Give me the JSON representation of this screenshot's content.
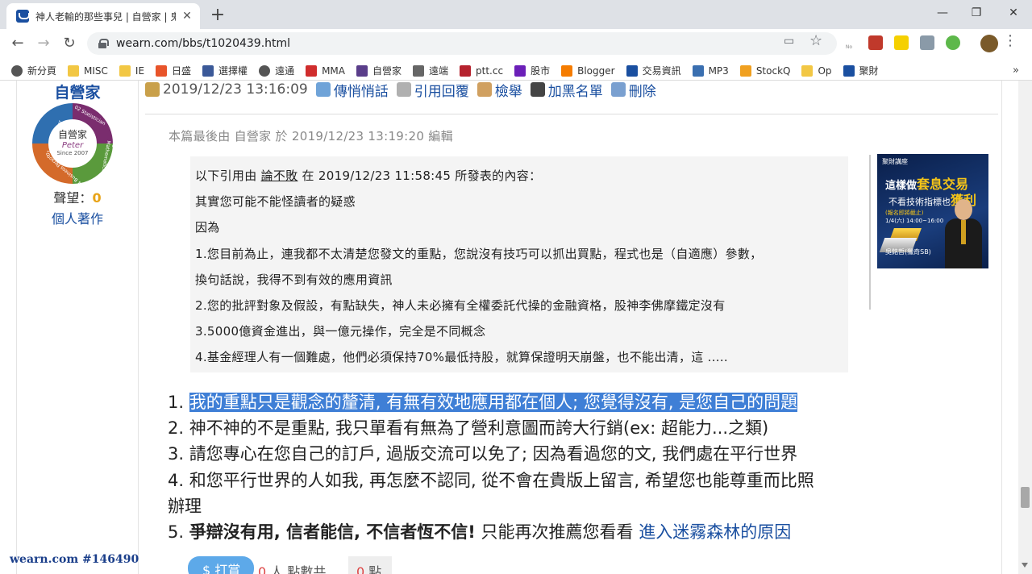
{
  "browser": {
    "tab_title": "神人老輸的那些事兒 | 自營家 | 鬼",
    "tab_close": "✕",
    "new_tab": "+",
    "win_min": "—",
    "win_max": "❐",
    "win_close": "✕",
    "back": "←",
    "forward": "→",
    "reload": "↻",
    "url": "wearn.com/bbs/t1020439.html",
    "star": "☆",
    "menu": "⋮",
    "ext_noads": "No ads",
    "bookmarks": [
      {
        "label": "新分頁",
        "color": "#555555",
        "icon": "globe-icon"
      },
      {
        "label": "MISC",
        "color": "#f2c744",
        "icon": "folder-icon"
      },
      {
        "label": "IE",
        "color": "#f2c744",
        "icon": "folder-icon"
      },
      {
        "label": "日盛",
        "color": "#e8542a",
        "icon": "wave-icon"
      },
      {
        "label": "選擇權",
        "color": "#3b5998",
        "icon": "facebook-icon"
      },
      {
        "label": "遠通",
        "color": "#555555",
        "icon": "globe-icon"
      },
      {
        "label": "MMA",
        "color": "#d02d2d",
        "icon": "mma-icon"
      },
      {
        "label": "自營家",
        "color": "#5a3e8a",
        "icon": "avatar-icon"
      },
      {
        "label": "遠端",
        "color": "#666666",
        "icon": "remote-icon"
      },
      {
        "label": "ptt.cc",
        "color": "#b5222e",
        "icon": "ptt-icon"
      },
      {
        "label": "股市",
        "color": "#6b1fb8",
        "icon": "yahoo-icon"
      },
      {
        "label": "Blogger",
        "color": "#f57c00",
        "icon": "blogger-icon"
      },
      {
        "label": "交易資訊",
        "color": "#1a4fa0",
        "icon": "grid-icon"
      },
      {
        "label": "MP3",
        "color": "#3a6fb0",
        "icon": "headphone-icon"
      },
      {
        "label": "StockQ",
        "color": "#f0a020",
        "icon": "q-icon"
      },
      {
        "label": "Op",
        "color": "#f2c744",
        "icon": "note-icon"
      },
      {
        "label": "聚財",
        "color": "#1a4fa0",
        "icon": "wearn-icon"
      }
    ],
    "bookmarks_more": "»"
  },
  "user": {
    "name": "自營家",
    "avatar_text1": "自營家",
    "avatar_text2": "Peter",
    "avatar_text3": "Since 2007",
    "avatar_arc1": "01 Programmer",
    "avatar_arc2": "02 Statistician",
    "avatar_arc3": "03 Mathematician",
    "avatar_arc4": "04 Business Person",
    "reputation_label": "聲望：",
    "reputation_value": "0",
    "works_link": "個人著作",
    "watermark": "wearn.com #146490"
  },
  "post": {
    "meta_date": "2019/12/23 13:16:09",
    "meta_actions": [
      "傳悄悄話",
      "引用回覆",
      "檢舉",
      "加黑名單",
      "刪除"
    ],
    "edit_note": "本篇最後由 自營家 於 2019/12/23 13:19:20 編輯",
    "quote": {
      "header_pre": "以下引用由 ",
      "header_user": "論不敗",
      "header_post": " 在 2019/12/23 11:58:45 所發表的內容：",
      "lines": [
        "其實您可能不能怪讀者的疑惑",
        "因為",
        "1.您目前為止，連我都不太清楚您發文的重點，您說沒有技巧可以抓出買點，程式也是（自適應）參數，",
        "換句話說，我得不到有效的應用資訊",
        "2.您的批評對象及假設，有點缺失，神人未必擁有全權委託代操的金融資格，股神李佛摩鐵定沒有",
        "3.5000億資金進出，與一億元操作，完全是不同概念",
        "4.基金經理人有一個難處，他們必須保持70%最低持股，就算保證明天崩盤，也不能出清，這 ....."
      ]
    },
    "answer": {
      "l1_num": "1. ",
      "l1_text": "我的重點只是觀念的釐清, 有無有效地應用都在個人; 您覺得沒有, 是您自己的問題",
      "l2": "2. 神不神的不是重點, 我只單看有無為了營利意圖而誇大行銷(ex: 超能力...之類)",
      "l3": "3. 請您專心在您自己的訂戶, 過版交流可以免了; 因為看過您的文, 我們處在平行世界",
      "l4a": "4. 和您平行世界的人如我, 再怎麼不認同, 從不會在貴版上留言, 希望您也能尊重而比照",
      "l4b": "辦理",
      "l5_num": "5. ",
      "l5_bold": "爭辯沒有用, 信者能信, 不信者恆不信!",
      "l5_text": " 只能再次推薦您看看 ",
      "l5_link": "進入迷霧森林的原因"
    },
    "tip_button": "$ 打賞",
    "tip_count": "0",
    "tip_text": " 人 點數共",
    "points_value": "0",
    "points_unit": " 點"
  },
  "ad": {
    "logo": "聚財講座",
    "line1_pre": "這樣做",
    "line1_hl": "套息交易",
    "line2_pre": "不看技術指標也",
    "line2_hl": "獲利",
    "line3": "(報名即將截止)",
    "line4": "1/4(六) 14:00~16:00",
    "line5": "吳銘哲(獵奇SB)"
  }
}
